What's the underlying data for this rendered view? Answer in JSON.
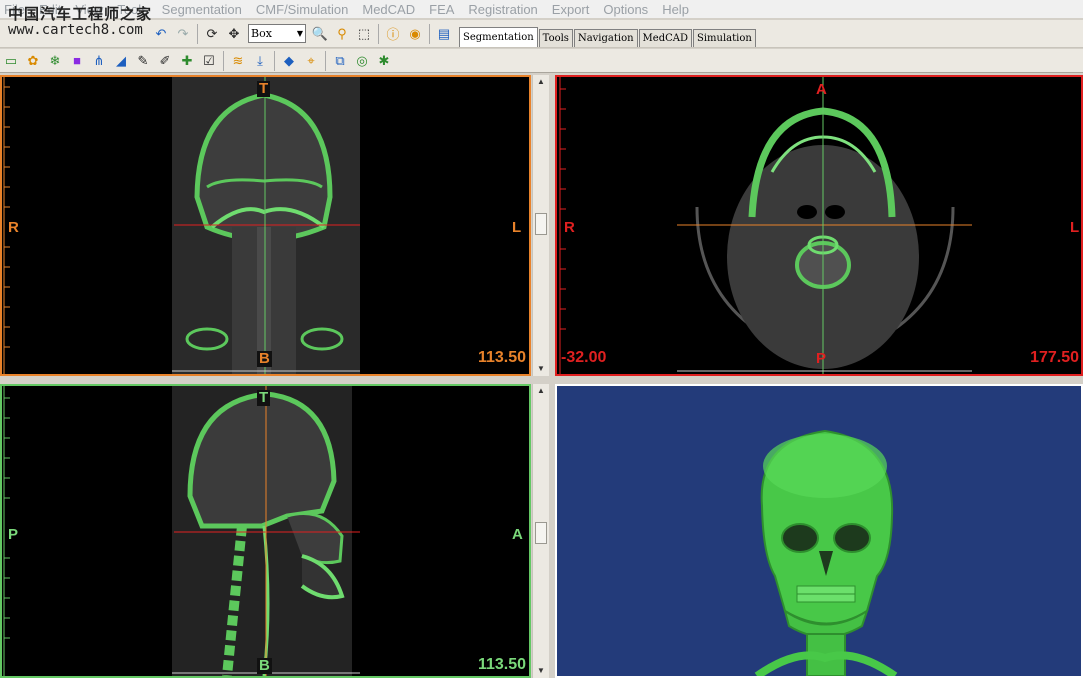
{
  "menu": [
    "File",
    "Edit",
    "View",
    "Tools",
    "Segmentation",
    "CMF/Simulation",
    "MedCAD",
    "FEA",
    "Registration",
    "Export",
    "Options",
    "Help"
  ],
  "watermark": {
    "line1": "中国汽车工程师之家",
    "line2": "www.cartech8.com"
  },
  "toolbar": {
    "combo_value": "Box",
    "tabs": [
      "Segmentation",
      "Tools",
      "Navigation",
      "MedCAD",
      "Simulation"
    ],
    "active_tab": "Segmentation"
  },
  "views": {
    "coronal": {
      "top": "T",
      "bottom": "B",
      "left": "R",
      "right": "L",
      "readout": "113.50",
      "border_color": "#e8822a",
      "label_color": "#e8822a"
    },
    "axial": {
      "top": "A",
      "bottom": "P",
      "left": "R",
      "right": "L",
      "readout_left": "-32.00",
      "readout": "177.50",
      "border_color": "#e02020",
      "label_color": "#e02020"
    },
    "sagittal": {
      "top": "T",
      "bottom": "B",
      "left": "P",
      "right": "A",
      "readout": "113.50",
      "border_color": "#64c864",
      "label_color": "#7ad87a"
    },
    "three_d": {
      "background": "#233b7a",
      "model_color": "#4fd24f"
    }
  }
}
